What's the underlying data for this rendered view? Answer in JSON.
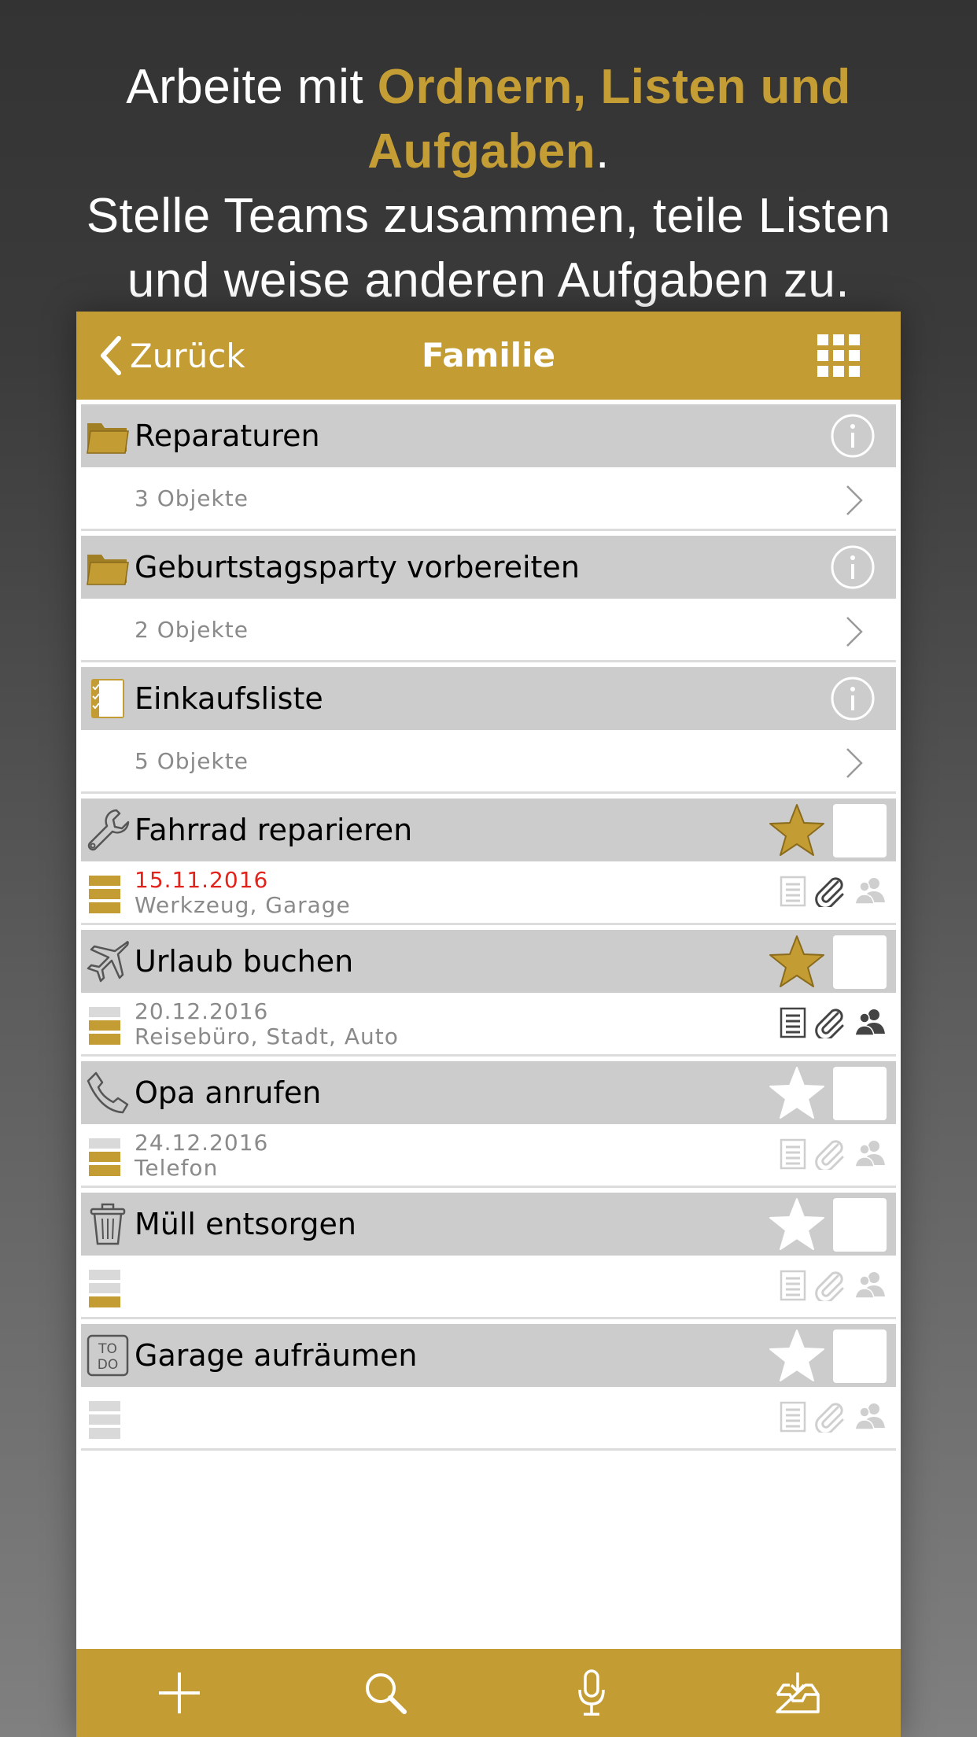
{
  "headline": {
    "line1_pre": "Arbeite mit ",
    "line1_accent": "Ordnern, Listen und Aufgaben",
    "line1_post": ".",
    "line2": "Stelle Teams zusammen, teile Listen",
    "line3": "und weise anderen Aufgaben zu."
  },
  "colors": {
    "accent": "#c39c34",
    "row_header": "#cccccc",
    "overdue": "#e0241b",
    "muted_text": "#8a8a8a"
  },
  "navbar": {
    "back_label": "Zurück",
    "title": "Familie",
    "grid_icon": "grid-icon"
  },
  "folders": [
    {
      "title": "Reparaturen",
      "count": "3 Objekte",
      "icon": "folder-icon"
    },
    {
      "title": "Geburtstagsparty vorbereiten",
      "count": "2 Objekte",
      "icon": "folder-icon"
    },
    {
      "title": "Einkaufsliste",
      "count": "5 Objekte",
      "icon": "checklist-icon"
    }
  ],
  "tasks": [
    {
      "title": "Fahrrad reparieren",
      "icon": "wrench-icon",
      "date": "15.11.2016",
      "tags": "Werkzeug, Garage",
      "starred": true,
      "overdue": true,
      "priority": 3,
      "has_note": false,
      "has_attachment": true,
      "shared": false
    },
    {
      "title": "Urlaub buchen",
      "icon": "airplane-icon",
      "date": "20.12.2016",
      "tags": "Reisebüro, Stadt, Auto",
      "starred": true,
      "overdue": false,
      "priority": 2,
      "has_note": true,
      "has_attachment": true,
      "shared": true
    },
    {
      "title": "Opa anrufen",
      "icon": "phone-icon",
      "date": "24.12.2016",
      "tags": "Telefon",
      "starred": false,
      "overdue": false,
      "priority": 2,
      "has_note": false,
      "has_attachment": false,
      "shared": false
    },
    {
      "title": "Müll entsorgen",
      "icon": "trash-icon",
      "date": "",
      "tags": "",
      "starred": false,
      "overdue": false,
      "priority": 1,
      "has_note": false,
      "has_attachment": false,
      "shared": false
    },
    {
      "title": "Garage aufräumen",
      "icon": "todo-icon",
      "date": "",
      "tags": "",
      "starred": false,
      "overdue": false,
      "priority": 0,
      "has_note": false,
      "has_attachment": false,
      "shared": false
    }
  ],
  "toolbar": [
    "add-icon",
    "search-icon",
    "microphone-icon",
    "inbox-download-icon"
  ]
}
